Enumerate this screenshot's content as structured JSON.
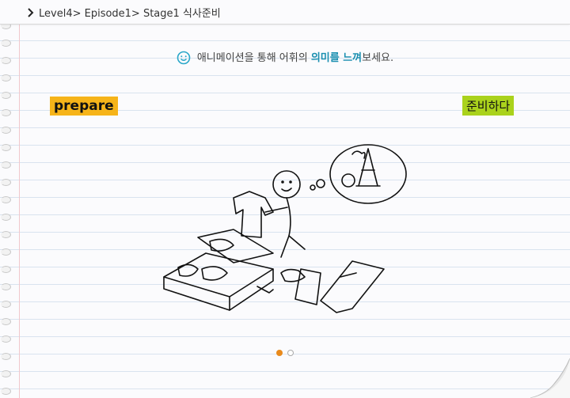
{
  "breadcrumb": {
    "icon": "chevron-right-icon",
    "text": "Level4> Episode1> Stage1 식사준비"
  },
  "instruction": {
    "icon": "smile-icon",
    "before": "애니메이션을 통해 어휘의 ",
    "highlight": "의미를 느껴",
    "after": "보세요.",
    "highlight_color": "#1a8fb0"
  },
  "vocab": {
    "english": "prepare",
    "korean": "준비하다",
    "english_bg": "#f6b419",
    "korean_bg": "#aad21c"
  },
  "pagination": {
    "total": 2,
    "current": 1,
    "active_color": "#e98a1c"
  }
}
